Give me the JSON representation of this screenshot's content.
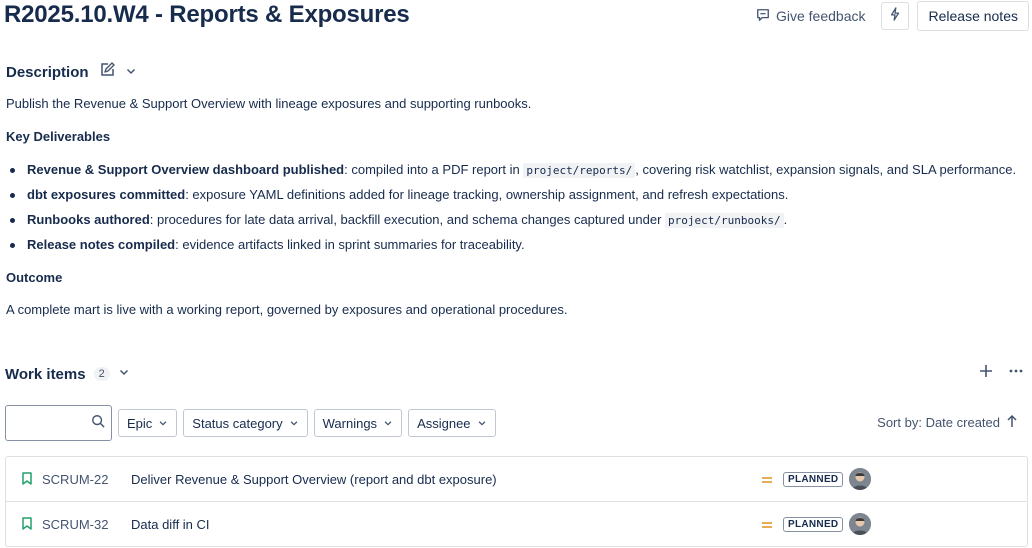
{
  "header": {
    "title": "R2025.10.W4 - Reports & Exposures",
    "feedback_label": "Give feedback",
    "release_notes_label": "Release notes"
  },
  "description": {
    "heading": "Description",
    "intro": "Publish the Revenue & Support Overview with lineage exposures and supporting runbooks.",
    "key_heading": "Key Deliverables",
    "bullets": [
      {
        "bold": "Revenue & Support Overview dashboard published",
        "pre": ": compiled into a PDF report in ",
        "code": "project/reports/",
        "post": ", covering risk watchlist, expansion signals, and SLA performance."
      },
      {
        "bold": "dbt exposures committed",
        "pre": ": exposure YAML definitions added for lineage tracking, ownership assignment, and refresh expectations.",
        "code": "",
        "post": ""
      },
      {
        "bold": "Runbooks authored",
        "pre": ": procedures for late data arrival, backfill execution, and schema changes captured under ",
        "code": "project/runbooks/",
        "post": "."
      },
      {
        "bold": "Release notes compiled",
        "pre": ": evidence artifacts linked in sprint summaries for traceability.",
        "code": "",
        "post": ""
      }
    ],
    "outcome_heading": "Outcome",
    "outcome": "A complete mart is live with a working report, governed by exposures and operational procedures."
  },
  "work_items": {
    "heading": "Work items",
    "count": "2",
    "search_placeholder": "",
    "filters": [
      "Epic",
      "Status category",
      "Warnings",
      "Assignee"
    ],
    "sort_label": "Sort by: Date created",
    "rows": [
      {
        "key": "SCRUM-22",
        "summary": "Deliver Revenue & Support Overview (report and dbt exposure)",
        "status": "PLANNED"
      },
      {
        "key": "SCRUM-32",
        "summary": "Data diff in CI",
        "status": "PLANNED"
      }
    ]
  },
  "colors": {
    "priority": "#e2a03f",
    "bookmark": "#22a06b",
    "text": "#172b4d"
  }
}
